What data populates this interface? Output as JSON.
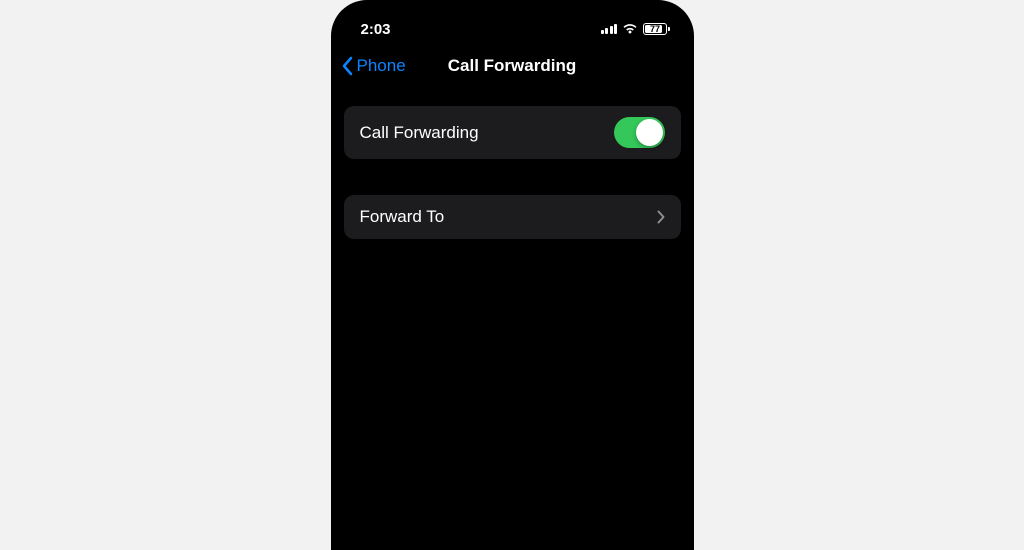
{
  "statusBar": {
    "time": "2:03",
    "batteryLevel": "77"
  },
  "nav": {
    "backLabel": "Phone",
    "title": "Call Forwarding"
  },
  "settings": {
    "callForwarding": {
      "label": "Call Forwarding",
      "enabled": true
    },
    "forwardTo": {
      "label": "Forward To",
      "value": ""
    }
  }
}
